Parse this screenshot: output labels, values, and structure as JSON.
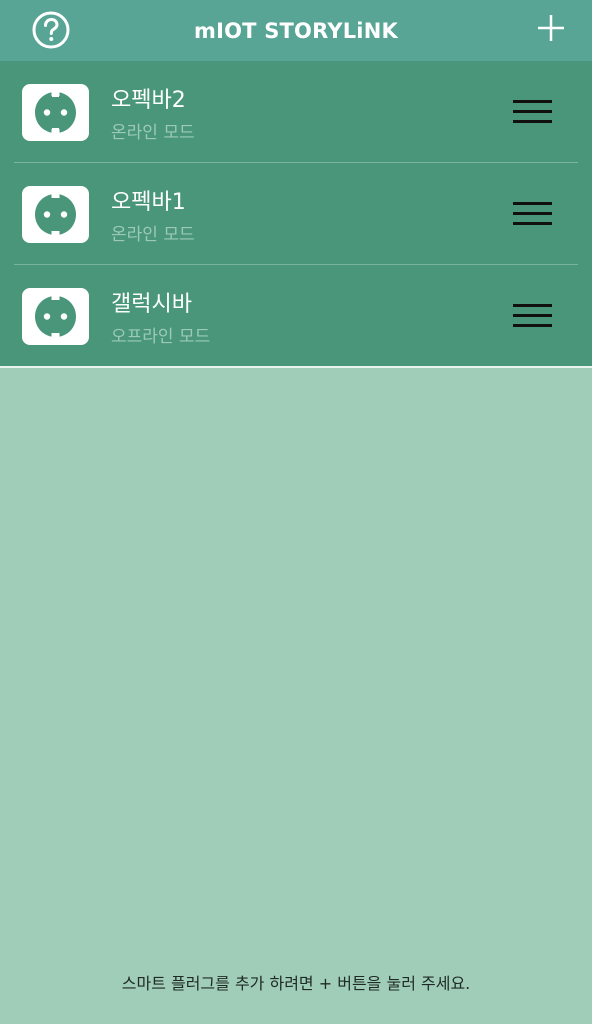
{
  "header": {
    "title": "mIOT STORYLiNK",
    "help_icon": "question-circle-icon",
    "add_icon": "plus-icon"
  },
  "devices": [
    {
      "name": "오펙바2",
      "status": "온라인 모드",
      "icon": "power-outlet-icon"
    },
    {
      "name": "오펙바1",
      "status": "온라인 모드",
      "icon": "power-outlet-icon"
    },
    {
      "name": "갤럭시바",
      "status": "오프라인 모드",
      "icon": "power-outlet-icon"
    }
  ],
  "footer": {
    "hint": "스마트 플러그를 추가 하려면 + 버튼을 눌러 주세요."
  },
  "colors": {
    "header_bg": "#58a596",
    "list_bg": "#4a967b",
    "page_bg": "#a0cdb8",
    "status_text": "#9ccab5"
  }
}
